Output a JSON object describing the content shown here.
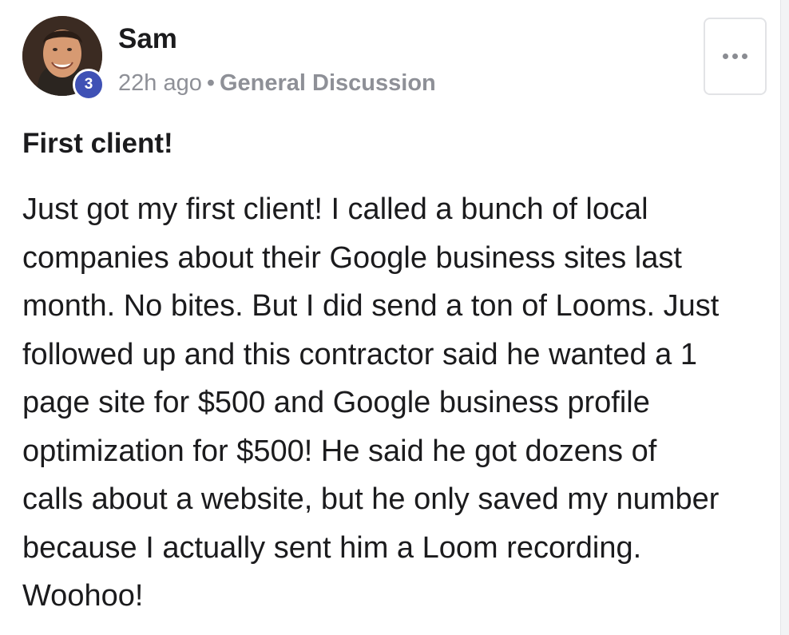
{
  "post": {
    "author": {
      "name": "Sam",
      "level": "3"
    },
    "meta": {
      "time": "22h ago",
      "separator": "•",
      "category": "General Discussion"
    },
    "title": "First client!",
    "body_lines": [
      "Just got my first client! I called a bunch of local",
      "companies about their Google business sites last",
      "month. No bites. But I did send a ton of Looms. Just",
      "followed up and this contractor said he wanted a 1",
      "page site for $500 and Google business profile",
      "optimization for $500! He said he got dozens of",
      "calls about a website, but he only saved my number",
      "because I actually sent him a Loom recording.",
      "Woohoo!"
    ]
  },
  "colors": {
    "level_badge": "#3f51b5",
    "text_primary": "#1b1b1d",
    "text_muted": "#8e9097"
  },
  "icons": {
    "more": "more-horizontal-icon"
  }
}
